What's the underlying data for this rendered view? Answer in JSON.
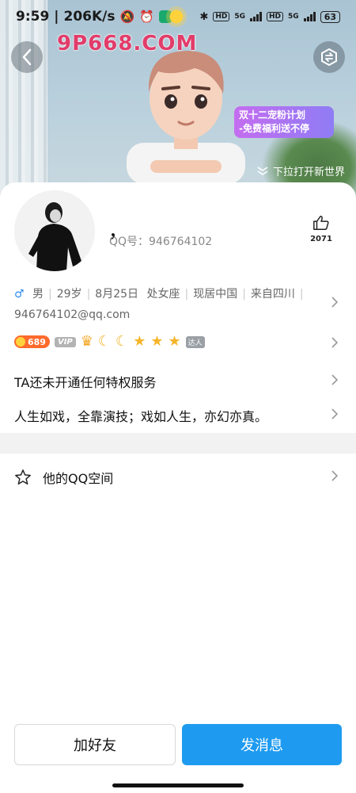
{
  "status_bar": {
    "time": "9:59",
    "net_speed": "206K/s",
    "battery": "63",
    "network_1": "5G",
    "network_2": "5G",
    "hd_1": "HD",
    "hd_2": "HD"
  },
  "header": {
    "watermark": "9P668.COM",
    "promo_line1": "双十二宠粉计划",
    "promo_line2": "-免费福利送不停",
    "pull_tip": "下拉打开新世界"
  },
  "profile": {
    "nickname": "，",
    "qq_label": "QQ号：946764102",
    "like_count": "2071",
    "gender": "男",
    "age": "29岁",
    "birthday": "8月25日",
    "zodiac": "处女座",
    "location": "现居中国",
    "hometown": "来自四川",
    "email": "946764102@qq.com"
  },
  "badges": {
    "level_value": "689",
    "vip_label": "VIP",
    "wing_label": "达人"
  },
  "rows": {
    "privilege": "TA还未开通任何特权服务",
    "signature": "人生如戏，全靠演技；戏如人生，亦幻亦真。",
    "qzone": "他的QQ空间"
  },
  "actions": {
    "add_friend": "加好友",
    "send_message": "发消息"
  },
  "colors": {
    "primary_button": "#1e9bf0",
    "watermark": "#e23c6a",
    "gender_icon": "#2d8cf0",
    "level_badge": "#ff6a2c"
  }
}
